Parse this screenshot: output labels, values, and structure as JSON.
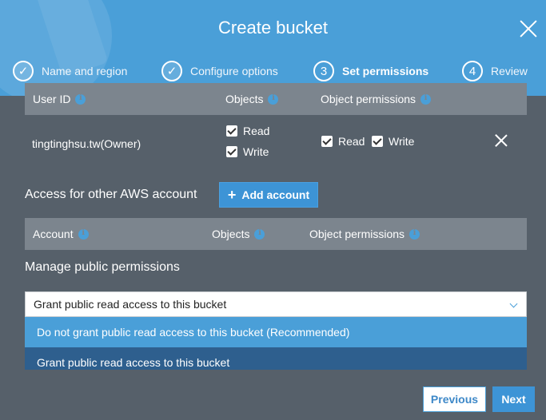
{
  "dialog": {
    "title": "Create bucket"
  },
  "steps": [
    {
      "label": "Name and region",
      "number": "",
      "state": "done"
    },
    {
      "label": "Configure options",
      "number": "",
      "state": "done"
    },
    {
      "label": "Set permissions",
      "number": "3",
      "state": "current"
    },
    {
      "label": "Review",
      "number": "4",
      "state": "pending"
    }
  ],
  "user_table": {
    "headers": [
      "User ID",
      "Objects",
      "Object permissions"
    ],
    "rows": [
      {
        "user": "tingtinghsu.tw(Owner)",
        "objects": [
          {
            "label": "Read",
            "checked": true
          },
          {
            "label": "Write",
            "checked": true
          }
        ],
        "object_permissions": [
          {
            "label": "Read",
            "checked": true
          },
          {
            "label": "Write",
            "checked": true
          }
        ]
      }
    ]
  },
  "other_accounts": {
    "label": "Access for other AWS account",
    "add_button": "Add account",
    "headers": [
      "Account",
      "Objects",
      "Object permissions"
    ]
  },
  "public_permissions": {
    "label": "Manage public permissions",
    "selected": "Grant public read access to this bucket",
    "options": [
      "Do not grant public read access to this bucket (Recommended)",
      "Grant public read access to this bucket"
    ]
  },
  "footer": {
    "previous": "Previous",
    "next": "Next"
  },
  "colors": {
    "header": "#4a9fd8",
    "background": "#56606a",
    "accent": "#3d94d6"
  }
}
